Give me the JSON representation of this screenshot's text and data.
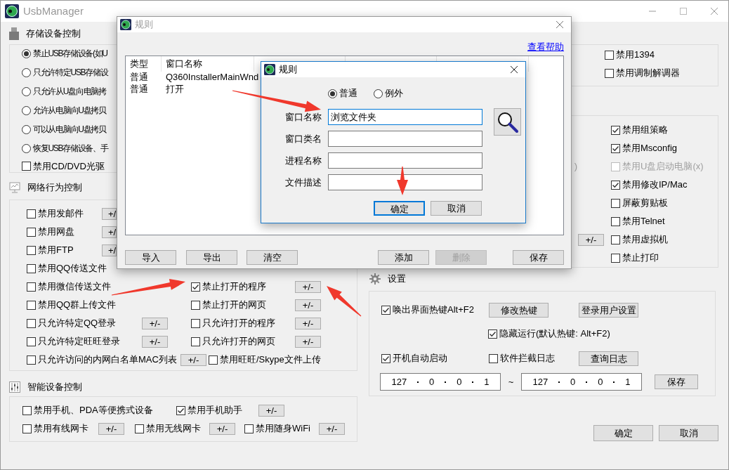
{
  "main_window": {
    "title": "UsbManager"
  },
  "storage": {
    "title": "存储设备控制",
    "options": [
      {
        "kind": "radio",
        "label": "禁止USB存储设备(如U",
        "selected": true
      },
      {
        "kind": "radio",
        "label": "只允许特定USB存储设",
        "selected": false
      },
      {
        "kind": "radio",
        "label": "只允许从U盘向电脑拷",
        "selected": false
      },
      {
        "kind": "radio",
        "label": "允许从电脑向U盘拷贝",
        "selected": false
      },
      {
        "kind": "radio",
        "label": "可以从电脑向U盘拷贝",
        "selected": false
      },
      {
        "kind": "radio",
        "label": "恢复USB存储设备、手",
        "selected": false
      },
      {
        "kind": "checkbox",
        "label": "禁用CD/DVD光驱",
        "checked": false
      }
    ]
  },
  "network": {
    "title": "网络行为控制",
    "rows": [
      [
        {
          "label": "禁用发邮件",
          "checked": false,
          "button": "+/"
        }
      ],
      [
        {
          "label": "禁用网盘",
          "checked": false,
          "button": "+/"
        }
      ],
      [
        {
          "label": "禁用FTP",
          "checked": false,
          "button": "+/"
        }
      ],
      [
        {
          "label": "禁用QQ传送文件",
          "checked": false
        }
      ],
      [
        {
          "label": "禁用微信传送文件",
          "checked": false
        },
        {
          "label": "禁止打开的程序",
          "checked": true,
          "button": "+/-"
        }
      ],
      [
        {
          "label": "禁用QQ群上传文件",
          "checked": false
        },
        {
          "label": "禁止打开的网页",
          "checked": false,
          "button": "+/-"
        }
      ],
      [
        {
          "label": "只允许特定QQ登录",
          "checked": false,
          "button": "+/-"
        },
        {
          "label": "只允许打开的程序",
          "checked": false,
          "button": "+/-"
        }
      ],
      [
        {
          "label": "只允许特定旺旺登录",
          "checked": false,
          "button": "+/-"
        },
        {
          "label": "只允许打开的网页",
          "checked": false,
          "button": "+/-"
        }
      ],
      [
        {
          "label": "只允许访问的内网白名单MAC列表",
          "checked": false,
          "button": "+/-"
        },
        {
          "label": "禁用旺旺/Skype文件上传",
          "checked": false
        }
      ]
    ]
  },
  "smart_devices": {
    "title": "智能设备控制",
    "rows": [
      [
        {
          "label": "禁用手机、PDA等便携式设备",
          "checked": false
        },
        {
          "label": "禁用手机助手",
          "checked": true,
          "button": "+/-"
        }
      ],
      [
        {
          "label": "禁用有线网卡",
          "checked": false,
          "button": "+/-"
        },
        {
          "label": "禁用无线网卡",
          "checked": false,
          "button": "+/-"
        },
        {
          "label": "禁用随身WiFi",
          "checked": false,
          "button": "+/-"
        }
      ]
    ]
  },
  "ports": {
    "options": [
      {
        "label": "禁用1394",
        "checked": false
      },
      {
        "label": "禁用调制解调器",
        "checked": false
      }
    ]
  },
  "system": {
    "options": [
      {
        "label": "禁用组策略",
        "checked": true,
        "disabled": false
      },
      {
        "label": "禁用Msconfig",
        "checked": true,
        "disabled": false
      },
      {
        "label": "禁用U盘启动电脑(x)",
        "checked": false,
        "disabled": true,
        "left_text": ")"
      },
      {
        "label": "禁用修改IP/Mac",
        "checked": true,
        "disabled": false
      },
      {
        "label": "屏蔽剪贴板",
        "checked": false,
        "disabled": false
      },
      {
        "label": "禁用Telnet",
        "checked": false,
        "disabled": false
      },
      {
        "label": "禁用虚拟机",
        "checked": false,
        "disabled": false,
        "left_button": "+/-"
      },
      {
        "label": "禁止打印",
        "checked": false,
        "disabled": false
      }
    ]
  },
  "settings": {
    "title": "设置",
    "hotkey": {
      "label": "唤出界面热键Alt+F2",
      "checked": true
    },
    "change_hotkey_button": "修改热键",
    "login_user_button": "登录用户设置",
    "hidden_run": {
      "label": "隐藏运行(默认热键: Alt+F2)",
      "checked": true
    },
    "autostart": {
      "label": "开机自动启动",
      "checked": true
    },
    "block_log": {
      "label": "软件拦截日志",
      "checked": false
    },
    "query_log_button": "查询日志",
    "ip_start": [
      "127",
      "0",
      "0",
      "1"
    ],
    "ip_separator": "~",
    "ip_end": [
      "127",
      "0",
      "0",
      "1"
    ],
    "save_button": "保存"
  },
  "footer_buttons": [
    "确定",
    "取消"
  ],
  "rules_dialog": {
    "title": "规则",
    "help_link": "查看帮助",
    "columns": [
      "类型",
      "窗口名称"
    ],
    "rows": [
      [
        "普通",
        "Q360InstallerMainWnd"
      ],
      [
        "普通",
        "打开"
      ]
    ],
    "buttons": [
      {
        "label": "导入",
        "disabled": false
      },
      {
        "label": "导出",
        "disabled": false
      },
      {
        "label": "清空",
        "disabled": false
      },
      {
        "label": "添加",
        "disabled": false
      },
      {
        "label": "删除",
        "disabled": true
      },
      {
        "label": "保存",
        "disabled": false
      }
    ]
  },
  "rule_edit_dialog": {
    "title": "规则",
    "types": [
      {
        "label": "普通",
        "selected": true
      },
      {
        "label": "例外",
        "selected": false
      }
    ],
    "fields": [
      {
        "label": "窗口名称",
        "value": "浏览文件夹",
        "focused": true
      },
      {
        "label": "窗口类名",
        "focused": false
      },
      {
        "label": "进程名称",
        "focused": false
      },
      {
        "label": "文件描述",
        "focused": false
      }
    ],
    "ok_button": "确定",
    "cancel_button": "取消"
  }
}
